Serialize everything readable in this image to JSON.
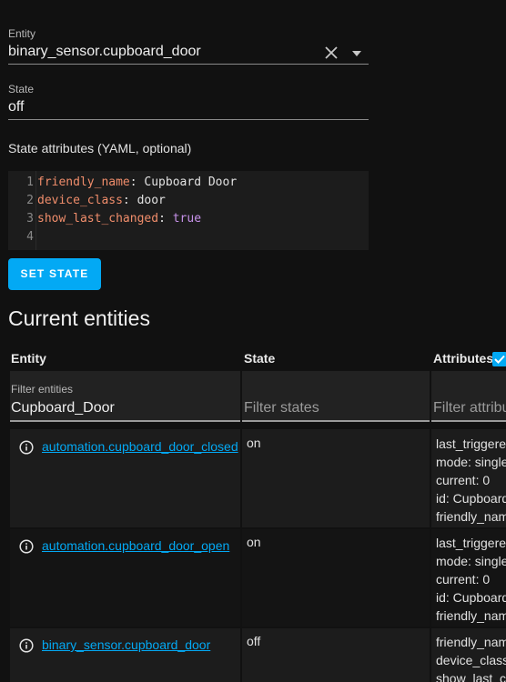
{
  "form": {
    "entity_label": "Entity",
    "entity_value": "binary_sensor.cupboard_door",
    "state_label": "State",
    "state_value": "off",
    "attributes_label": "State attributes (YAML, optional)",
    "yaml_lines": [
      {
        "num": "1",
        "key": "friendly_name",
        "value": "Cupboard Door",
        "value_type": "string"
      },
      {
        "num": "2",
        "key": "device_class",
        "value": "door",
        "value_type": "string"
      },
      {
        "num": "3",
        "key": "show_last_changed",
        "value": "true",
        "value_type": "keyword"
      },
      {
        "num": "4",
        "key": "",
        "value": "",
        "value_type": "string"
      }
    ],
    "set_state_label": "SET STATE"
  },
  "entities": {
    "title": "Current entities",
    "columns": {
      "entity": "Entity",
      "state": "State",
      "attributes": "Attributes"
    },
    "filters": {
      "entity_label": "Filter entities",
      "entity_value": "Cupboard_Door",
      "state_placeholder": "Filter states",
      "attributes_placeholder": "Filter attributes"
    },
    "rows": [
      {
        "entity": "automation.cupboard_door_closed",
        "state": "on",
        "attributes": [
          "last_triggered",
          "mode: single",
          "current: 0",
          "id: Cupboard",
          "friendly_name"
        ]
      },
      {
        "entity": "automation.cupboard_door_open",
        "state": "on",
        "attributes": [
          "last_triggered",
          "mode: single",
          "current: 0",
          "id: Cupboard",
          "friendly_name"
        ]
      },
      {
        "entity": "binary_sensor.cupboard_door",
        "state": "off",
        "attributes": [
          "friendly_name",
          "device_class",
          "show_last_changed"
        ]
      }
    ]
  },
  "colors": {
    "accent": "#03a9f4",
    "background": "#111111",
    "surface": "#1c1c1c",
    "yaml_key": "#f08d6b",
    "yaml_keyword": "#c792ea"
  }
}
